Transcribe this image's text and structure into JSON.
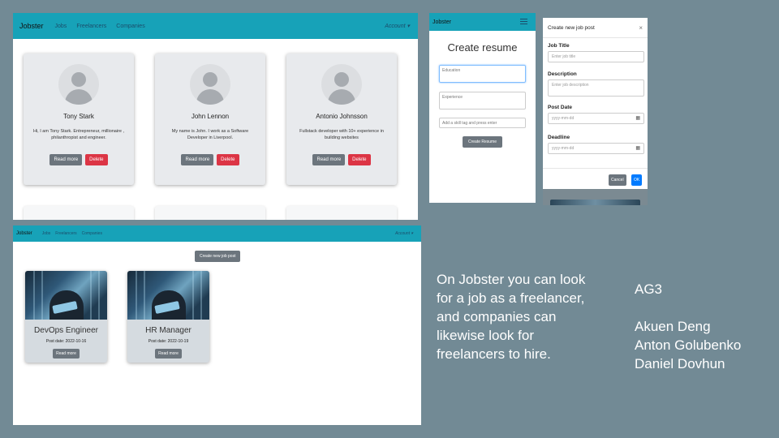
{
  "freelancers_page": {
    "brand": "Jobster",
    "nav": [
      "Jobs",
      "Freelancers",
      "Companies"
    ],
    "account": "Account ▾",
    "cards": [
      {
        "name": "Tony Stark",
        "bio": "Hi, I am Tony Stark. Entrepreneur, millionaire , philanthropist and engineer.",
        "read_more": "Read more",
        "delete": "Delete"
      },
      {
        "name": "John Lennon",
        "bio": "My name is John. I work as a Software Developer in Liverpool.",
        "read_more": "Read more",
        "delete": "Delete"
      },
      {
        "name": "Antonio Johnsson",
        "bio": "Fullstack developer with 10+ experience in building websites",
        "read_more": "Read more",
        "delete": "Delete"
      }
    ]
  },
  "resume_page": {
    "brand": "Jobster",
    "title": "Create resume",
    "education_placeholder": "Education",
    "experience_placeholder": "Experience",
    "skill_placeholder": "Add a skill tag and press enter",
    "submit": "Create Resume"
  },
  "job_modal": {
    "title": "Create new job post",
    "close": "×",
    "job_title_label": "Job Title",
    "job_title_placeholder": "Enter job title",
    "description_label": "Description",
    "description_placeholder": "Enter job description",
    "post_date_label": "Post Date",
    "post_date_placeholder": "yyyy-mm-dd",
    "deadline_label": "Deadline",
    "deadline_placeholder": "yyyy-mm-dd",
    "cancel": "Cancel",
    "ok": "OK"
  },
  "jobs_page": {
    "brand": "Jobster",
    "nav": [
      "Jobs",
      "Freelancers",
      "Companies"
    ],
    "account": "Account ▾",
    "create_button": "Create new job post",
    "jobs": [
      {
        "title": "DevOps Engineer",
        "post_date": "Post date: 2022-10-16",
        "read_more": "Read more"
      },
      {
        "title": "HR Manager",
        "post_date": "Post date: 2022-10-19",
        "read_more": "Read more"
      }
    ]
  },
  "description": "On Jobster you can look for a job as a freelancer, and companies can likewise look for freelancers to hire.",
  "team": {
    "group": "AG3",
    "members": [
      "Akuen Deng",
      "Anton Golubenko",
      "Daniel Dovhun"
    ]
  }
}
